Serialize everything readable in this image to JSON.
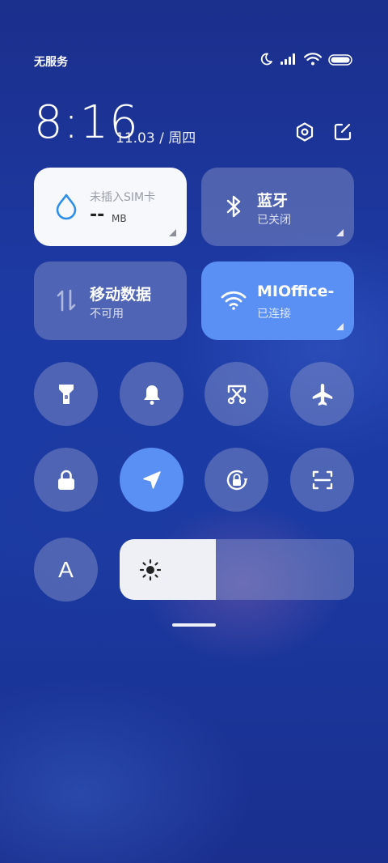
{
  "status_bar": {
    "carrier": "无服务",
    "icons": [
      "moon-icon",
      "signal-icon",
      "wifi-icon",
      "battery-icon"
    ]
  },
  "header": {
    "time": "8:16",
    "date": "11.03 / 周四",
    "icons": [
      "settings-icon",
      "edit-icon"
    ]
  },
  "tiles": {
    "data_usage": {
      "title": "未插入SIM卡",
      "value": "--",
      "unit": "MB",
      "icon": "water-drop-icon"
    },
    "bluetooth": {
      "title": "蓝牙",
      "status": "已关闭",
      "icon": "bluetooth-icon"
    },
    "mobile_data": {
      "title": "移动数据",
      "status": "不可用",
      "icon": "data-arrows-icon"
    },
    "wifi": {
      "title": "MIOffice-",
      "status": "已连接",
      "icon": "wifi-icon",
      "active": true
    }
  },
  "toggles": [
    {
      "name": "flashlight",
      "icon": "flashlight-icon",
      "active": false
    },
    {
      "name": "mute",
      "icon": "bell-icon",
      "active": false
    },
    {
      "name": "screenshot",
      "icon": "scissors-icon",
      "active": false
    },
    {
      "name": "airplane-mode",
      "icon": "airplane-icon",
      "active": false
    },
    {
      "name": "lock-screen",
      "icon": "lock-icon",
      "active": false
    },
    {
      "name": "location",
      "icon": "location-arrow-icon",
      "active": true
    },
    {
      "name": "rotation-lock",
      "icon": "rotation-lock-icon",
      "active": false
    },
    {
      "name": "scanner",
      "icon": "scan-icon",
      "active": false
    },
    {
      "name": "reading-mode",
      "icon": "font-a-icon",
      "active": false,
      "label": "A"
    }
  ],
  "brightness": {
    "level": 0.41,
    "icon": "sun-icon"
  },
  "colors": {
    "accent": "#5a8ff3",
    "tile_dim": "rgba(150,160,205,0.42)",
    "background": "#1d3aa4"
  }
}
